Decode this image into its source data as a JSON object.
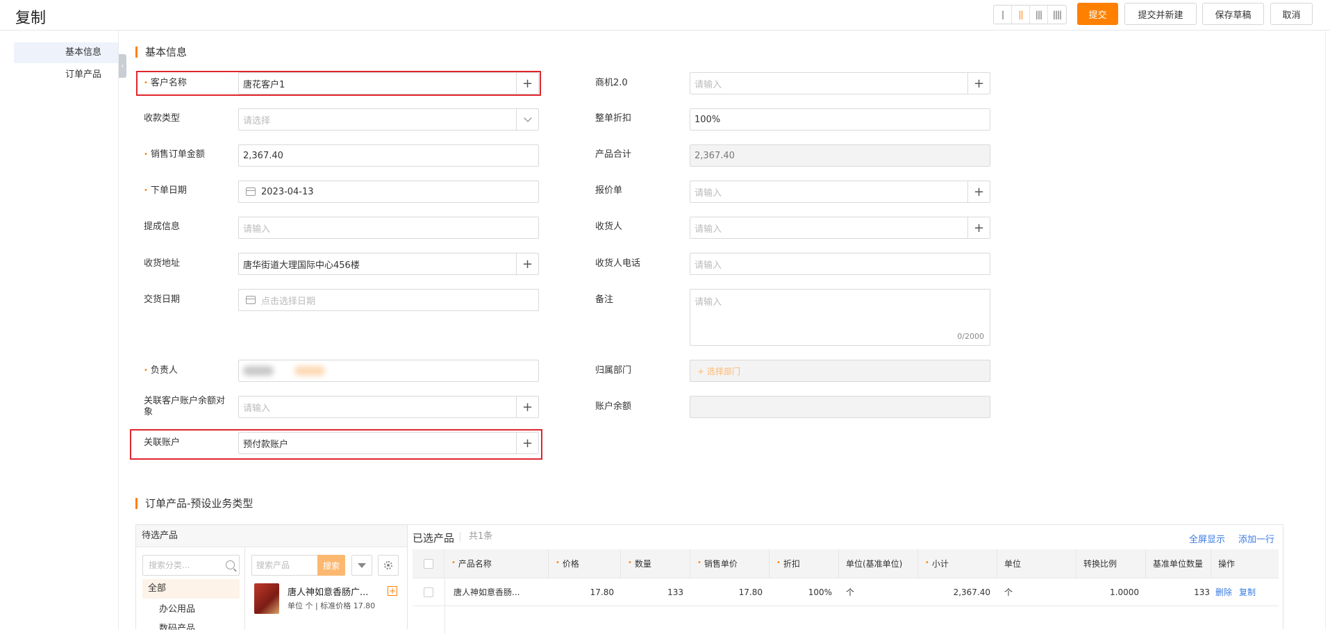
{
  "page": {
    "title": "复制"
  },
  "toolbar": {
    "layouts": [
      "|",
      "||",
      "|||",
      "||||"
    ],
    "submit": "提交",
    "submit_new": "提交并新建",
    "save_draft": "保存草稿",
    "cancel": "取消"
  },
  "nav": {
    "items": [
      "基本信息",
      "订单产品"
    ]
  },
  "sections": {
    "basic": "基本信息",
    "products": "订单产品-预设业务类型"
  },
  "form": {
    "customer": {
      "label": "客户名称",
      "value": "唐花客户1"
    },
    "opportunity": {
      "label": "商机2.0",
      "placeholder": "请输入"
    },
    "payment_type": {
      "label": "收款类型",
      "placeholder": "请选择"
    },
    "discount": {
      "label": "整单折扣",
      "value": "100%"
    },
    "order_amount": {
      "label": "销售订单金额",
      "value": "2,367.40"
    },
    "product_total": {
      "label": "产品合计",
      "value": "2,367.40"
    },
    "order_date": {
      "label": "下单日期",
      "value": "2023-04-13"
    },
    "quote": {
      "label": "报价单",
      "placeholder": "请输入"
    },
    "commission": {
      "label": "提成信息",
      "placeholder": "请输入"
    },
    "consignee": {
      "label": "收货人",
      "placeholder": "请输入"
    },
    "address": {
      "label": "收货地址",
      "value": "唐华街道大理国际中心456楼"
    },
    "consignee_phone": {
      "label": "收货人电话",
      "placeholder": "请输入"
    },
    "delivery_date": {
      "label": "交货日期",
      "placeholder": "点击选择日期"
    },
    "remark": {
      "label": "备注",
      "placeholder": "请输入",
      "count": "0/2000"
    },
    "owner": {
      "label": "负责人"
    },
    "department": {
      "label": "归属部门",
      "placeholder": "+ 选择部门"
    },
    "balance_object": {
      "label": "关联客户账户余额对象",
      "placeholder": "请输入"
    },
    "balance": {
      "label": "账户余额",
      "value": ""
    },
    "account": {
      "label": "关联账户",
      "value": "预付款账户"
    }
  },
  "products_panel": {
    "pending_title": "待选产品",
    "category_search_placeholder": "搜索分类...",
    "categories": [
      "全部",
      "办公用品",
      "数码产品"
    ],
    "product_search_placeholder": "搜索产品",
    "search_button": "搜索",
    "product": {
      "name": "唐人神如意香肠广...",
      "meta": "单位 个 | 标准价格 17.80"
    }
  },
  "selected_panel": {
    "title": "已选产品",
    "count": "共1条",
    "fullscreen": "全屏显示",
    "add_row": "添加一行",
    "columns": [
      "产品名称",
      "价格",
      "数量",
      "销售单价",
      "折扣",
      "单位(基准单位)",
      "小计",
      "单位",
      "转换比例",
      "基准单位数量",
      "操作"
    ],
    "rows": [
      {
        "name": "唐人神如意香肠...",
        "price": "17.80",
        "qty": "133",
        "unit_price": "17.80",
        "discount": "100%",
        "base_unit": "个",
        "subtotal": "2,367.40",
        "unit": "个",
        "ratio": "1.0000",
        "base_qty": "133",
        "op_delete": "删除",
        "op_copy": "复制"
      }
    ]
  }
}
